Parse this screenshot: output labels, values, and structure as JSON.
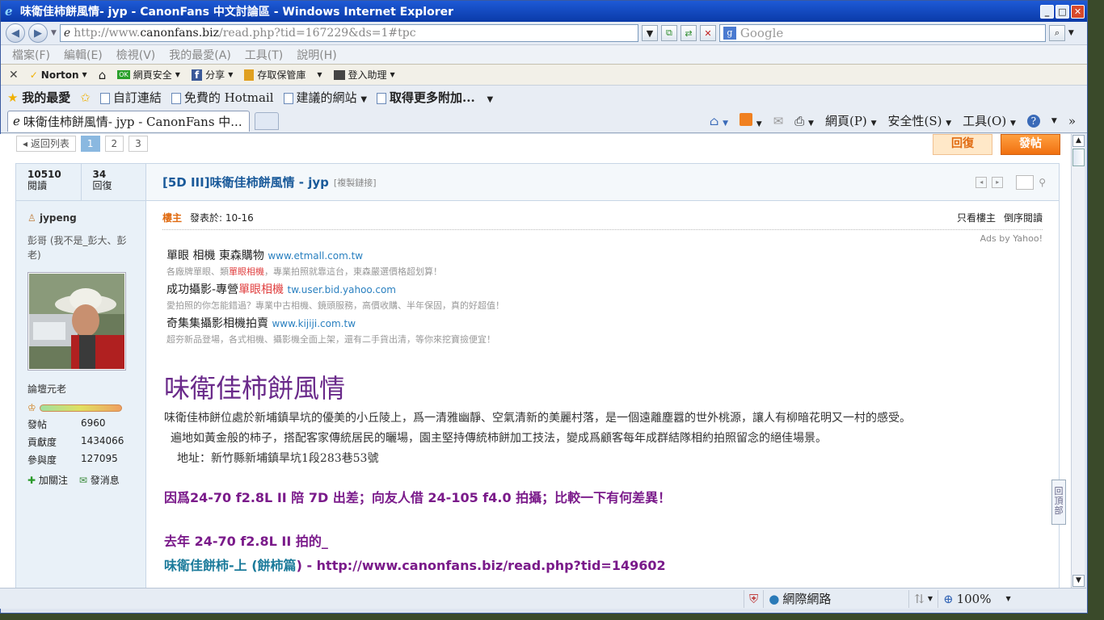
{
  "window": {
    "title": "味衛佳柿餅風情- jyp - CanonFans 中文討論區 - Windows Internet Explorer"
  },
  "address": {
    "prefix": "http://www.",
    "host": "canonfans.biz",
    "path": "/read.php?tid=167229&ds=1#tpc"
  },
  "search": {
    "placeholder": "Google"
  },
  "menu": [
    "檔案(F)",
    "編輯(E)",
    "檢視(V)",
    "我的最愛(A)",
    "工具(T)",
    "說明(H)"
  ],
  "norton": {
    "brand": "Norton",
    "web_safety": "網頁安全",
    "share": "分享",
    "vault": "存取保管庫",
    "login": "登入助理"
  },
  "favorites": {
    "label": "我的最愛",
    "items": [
      "自訂連結",
      "免費的 Hotmail",
      "建議的網站",
      "取得更多附加..."
    ]
  },
  "tab": {
    "label": "味衛佳柿餅風情- jyp - CanonFans 中..."
  },
  "commands": {
    "page": "網頁(P)",
    "safety": "安全性(S)",
    "tools": "工具(O)"
  },
  "pager": {
    "back": "返回列表",
    "pages": [
      "1",
      "2",
      "3"
    ]
  },
  "buttons": {
    "reply": "回復",
    "post": "發帖"
  },
  "stats": {
    "views": "10510",
    "views_label": "閱讀",
    "replies": "34",
    "replies_label": "回復"
  },
  "user": {
    "name": "jypeng",
    "nick": "彭哥 (我不是_彭大、彭老)",
    "rank": "論壇元老",
    "stats": [
      {
        "k": "發帖",
        "v": "6960"
      },
      {
        "k": "貢獻度",
        "v": "1434066"
      },
      {
        "k": "參與度",
        "v": "127095"
      }
    ],
    "follow": "加關注",
    "message": "發消息"
  },
  "post": {
    "title": "[5D III]味衛佳柿餅風情 - jyp",
    "copy_link": "[複製鏈接]",
    "owner": "樓主",
    "posted": "發表於: 10-16",
    "only_owner": "只看樓主",
    "reverse": "倒序閱讀",
    "ads_by": "Ads by Yahoo!"
  },
  "ads": [
    {
      "t1": "單眼 相機 東森購物",
      "u": "www.etmall.com.tw",
      "d1": "各廠牌單眼、類",
      "dh": "單眼相機",
      "d2": "，專業拍照就靠這台，東森嚴選價格超划算！"
    },
    {
      "t1": "成功攝影-專營",
      "th": "單眼相機",
      "u": "tw.user.bid.yahoo.com",
      "d1": "愛拍照的你怎能錯過？專業中古相機、鏡頭服務，高價收購、半年保固，真的好超值！"
    },
    {
      "t1": "奇集集攝影相機拍賣",
      "u": "www.kijiji.com.tw",
      "d1": "超夯新品登場，各式相機、攝影機全面上架，還有二手貨出清，等你來挖寶撿便宜！"
    }
  ],
  "article": {
    "title": "味衛佳柿餅風情",
    "p1": "味衛佳柿餅位處於新埔鎮旱坑的優美的小丘陵上，爲一清雅幽靜、空氣清新的美麗村落，是一個遠離塵囂的世外桃源，讓人有柳暗花明又一村的感受。",
    "p2": "遍地如黃金般的柿子，搭配客家傳統居民的曬場，園主堅持傳統柿餅加工技法，變成爲顧客每年成群結隊相約拍照留念的絕佳場景。",
    "p3": "地址：新竹縣新埔鎮旱坑1段283巷53號",
    "note": "因爲24-70 f2.8L II 陪 7D 出差；向友人借 24-105 f4.0 拍攝；比較一下有何差異！",
    "last_year": "去年 24-70 f2.8L II 拍的_",
    "link_prefix": "味衛佳餅柿",
    "link_mid": "-上 (",
    "link_mid2": "餅柿篇",
    "link_suffix": ") - http://www.canonfans.biz/read.php?tid=149602"
  },
  "totop": "回頂部",
  "status": {
    "zone": "網際網路",
    "zoom": "100%"
  }
}
